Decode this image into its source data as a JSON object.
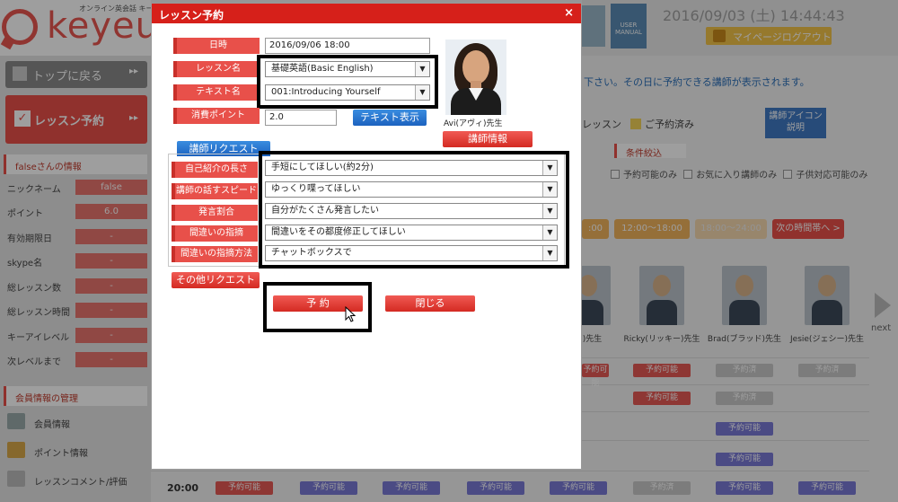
{
  "background": {
    "logo": {
      "word": "keyeu",
      "tagline": "オンライン英会話 キー"
    },
    "sidebar": {
      "top_button": "トップに戻る",
      "lesson_button": "レッスン予約",
      "lesson_check": "✓",
      "arrow": "▸▸",
      "info_heading": "falseさんの情報",
      "info_rows": [
        {
          "key": "ニックネーム",
          "value": "false"
        },
        {
          "key": "ポイント",
          "value": "6.0"
        },
        {
          "key": "有効期限日",
          "value": "-"
        },
        {
          "key": "skype名",
          "value": "-"
        },
        {
          "key": "総レッスン数",
          "value": "-"
        },
        {
          "key": "総レッスン時間",
          "value": "-"
        },
        {
          "key": "キーアイレベル",
          "value": "-"
        },
        {
          "key": "次レベルまで",
          "value": "-"
        }
      ],
      "member_heading": "会員情報の管理",
      "member_menu": [
        "会員情報",
        "ポイント情報",
        "レッスンコメント/評価"
      ]
    },
    "topbar": {
      "manual_icon_label": "USER MANUAL",
      "datetime": "2016/09/03 (土) 14:44:43",
      "logout": "マイページログアウト"
    },
    "notice": "下さい。その日に予約できる講師が表示されます。",
    "legend": {
      "lesson": "レッスン",
      "booked": "ご予約済み"
    },
    "teacher_icon_button": [
      "講師アイコン",
      "説明"
    ],
    "filter_title": "条件絞込",
    "filters": [
      "予約可能のみ",
      "お気に入り講師のみ",
      "子供対応可能のみ"
    ],
    "time_tabs": [
      ":00",
      "12:00～18:00",
      "18:00～24:00",
      "次の時間帯へ >"
    ],
    "teachers": [
      {
        "name": "ィ)先生"
      },
      {
        "name": "Ricky(リッキー)先生"
      },
      {
        "name": "Brad(ブラッド)先生"
      },
      {
        "name": "Jesie(ジェシー)先生"
      }
    ],
    "next_label": "next",
    "slot_available": "予約可能",
    "slot_closed": "予約済",
    "row_time": "20:00"
  },
  "modal": {
    "title": "レッスン予約",
    "close": "×",
    "fields": {
      "datetime": {
        "label": "日時",
        "value": "2016/09/06 18:00"
      },
      "lesson_name": {
        "label": "レッスン名",
        "value": "基礎英語(Basic English)"
      },
      "text_name": {
        "label": "テキスト名",
        "value": "001:Introducing Yourself"
      },
      "points": {
        "label": "消費ポイント",
        "value": "2.0"
      }
    },
    "text_view_button": "テキスト表示",
    "teacher": {
      "name": "Avi(アヴィ)先生",
      "info_button": "講師情報"
    },
    "request_tab": "講師リクエスト",
    "requests": [
      {
        "label": "自己紹介の長さ",
        "value": "手短にしてほしい(約2分)"
      },
      {
        "label": "講師の話すスピード",
        "value": "ゆっくり喋ってほしい"
      },
      {
        "label": "発言割合",
        "value": "自分がたくさん発言したい"
      },
      {
        "label": "間違いの指摘",
        "value": "間違いをその都度修正してほしい"
      },
      {
        "label": "間違いの指摘方法",
        "value": "チャットボックスで"
      }
    ],
    "other_request_button": "その他リクエスト",
    "reserve_button": "予 約",
    "close_button": "閉じる"
  },
  "colors": {
    "accent_red": "#d6201a",
    "button_blue": "#1c62bf",
    "label_red": "#e8504a"
  }
}
